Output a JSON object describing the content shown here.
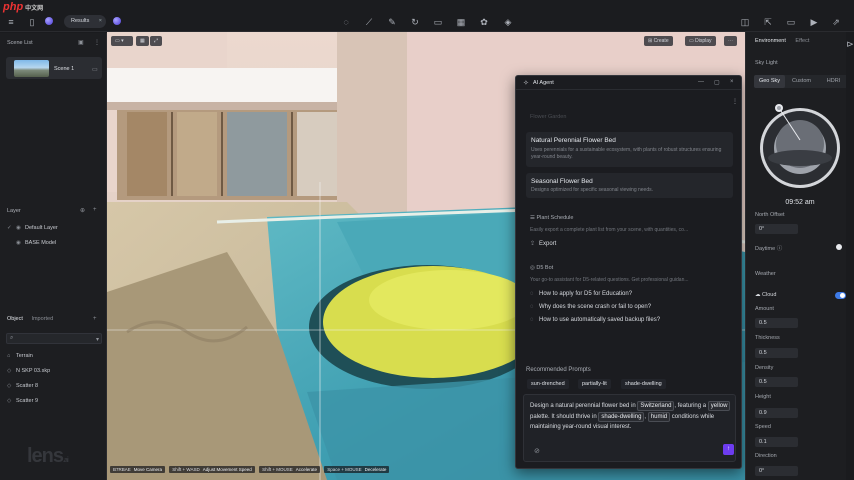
{
  "app": {
    "logo_text": "php",
    "logo_sub": "中文网",
    "toolbar_pill": "Results"
  },
  "left": {
    "scene_list_title": "Scene List",
    "scene_name": "Scene 1",
    "layer_title": "Layer",
    "layers": [
      "Default Layer",
      "BASE Model"
    ],
    "object_tab": "Object",
    "imported_tab": "Imported",
    "objects": [
      "Terrain",
      "N SKP 03.skp",
      "Scatter 8",
      "Scatter 9"
    ],
    "watermark": "lens"
  },
  "viewport": {
    "create_btn": "Create",
    "display_btn": "Display",
    "status": [
      {
        "k": "B7RBAE",
        "v": "Move Camera"
      },
      {
        "k": "Shift + WASD",
        "v": "Adjust Movement Speed"
      },
      {
        "k": "Shift + MOUSE",
        "v": "Accelerate"
      },
      {
        "k": "Space + MOUSE",
        "v": "Decelerate"
      }
    ]
  },
  "agent": {
    "title": "AI Agent",
    "faded_top": "Flower Garden",
    "card1_title": "Natural Perennial Flower Bed",
    "card1_desc": "Uses perennials for a sustainable ecosystem, with plants of robust structures ensuring year-round beauty.",
    "card2_title": "Seasonal Flower Bed",
    "card2_desc": "Designs optimized for specific seasonal viewing needs.",
    "plant_title": "Plant Schedule",
    "plant_desc": "Easily export a complete plant list from your scene, with quantities, co...",
    "export_label": "Export",
    "ds_title": "D5 Bot",
    "ds_desc": "Your go-to assistant for D5-related questions. Get professional guidan...",
    "questions": [
      "How to apply for D5 for Education?",
      "Why does the scene crash or fail to open?",
      "How to use automatically saved backup files?"
    ],
    "recommended_title": "Recommended Prompts",
    "chips": [
      "sun-drenched",
      "partially-lit",
      "shade-dwelling"
    ],
    "prompt": {
      "p1": "Design a natural perennial flower bed in",
      "t1": "Switzerland",
      "p2": ", featuring a",
      "t2": "yellow",
      "p3": "palette. It should thrive in",
      "t3": "shade-dwelling",
      "p4": ",",
      "t4": "humid",
      "p5": "conditions while maintaining year-round visual interest."
    }
  },
  "right": {
    "tab_environment": "Environment",
    "tab_effect": "Effect",
    "sky_light": "Sky Light",
    "seg": [
      "Geo Sky",
      "Custom",
      "HDRI"
    ],
    "time": "09:52 am",
    "north_offset_label": "North Offset",
    "north_offset_value": "0°",
    "daylight_label": "Daytime",
    "weather_label": "Weather",
    "cloud_label": "Cloud",
    "amount_label": "Amount",
    "amount_value": "0.5",
    "thickness_label": "Thickness",
    "thickness_value": "0.5",
    "density_label": "Density",
    "density_value": "0.5",
    "height_label": "Height",
    "height_value": "0.9",
    "speed_label": "Speed",
    "speed_value": "0.1",
    "direction_label": "Direction",
    "direction_value": "0°"
  },
  "colors": {
    "accent": "#6d3cf0",
    "toggle": "#3e7be8"
  }
}
